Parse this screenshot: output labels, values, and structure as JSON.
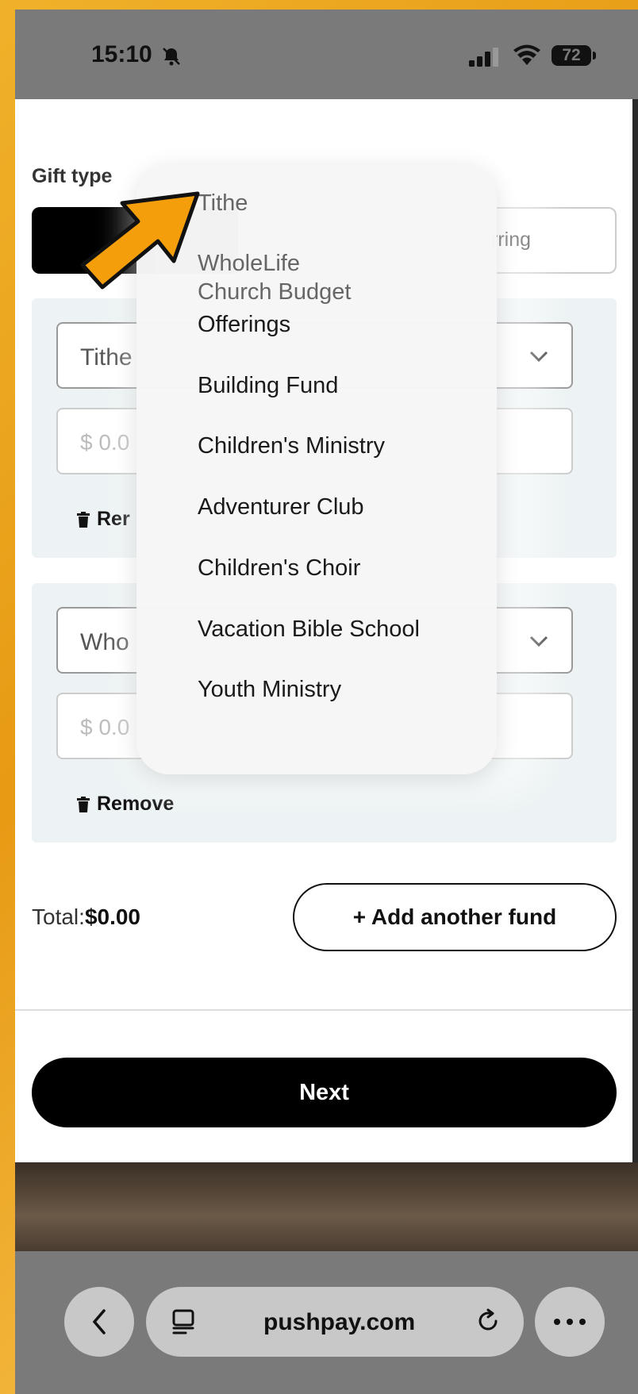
{
  "status": {
    "time": "15:10",
    "battery": "72"
  },
  "form": {
    "gift_type_label": "Gift type",
    "segment_right_label": "rring",
    "funds": [
      {
        "selected": "Tithe",
        "amount_placeholder": "$ 0.0",
        "remove_label": "Rer"
      },
      {
        "selected": "Who",
        "amount_placeholder": "$ 0.0",
        "remove_label": "Remove"
      }
    ],
    "total_label": "Total:",
    "total_value": "$0.00",
    "add_fund_label": "+ Add another fund",
    "next_label": "Next"
  },
  "dropdown": {
    "items": [
      "Tithe",
      "WholeLife",
      "Church Budget",
      "Offerings",
      "Building Fund",
      "Children's Ministry",
      "Adventurer Club",
      "Children's Choir",
      "Vacation Bible School",
      "Youth Ministry"
    ]
  },
  "browser": {
    "url": "pushpay.com"
  },
  "annotation": {
    "arrow_color": "#f59e0b"
  }
}
